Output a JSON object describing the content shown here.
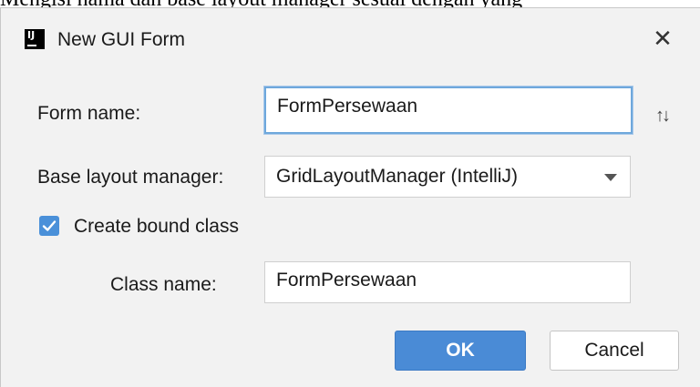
{
  "background_text": "Mengisi nama dan base layout manager sesuai dengan yang",
  "dialog": {
    "title": "New GUI Form",
    "app_icon_text": "IJ",
    "close_glyph": "✕"
  },
  "form": {
    "form_name_label": "Form name:",
    "form_name_value": "FormPersewaan",
    "base_layout_label": "Base layout manager:",
    "base_layout_value": "GridLayoutManager (IntelliJ)",
    "create_bound_label": "Create bound class",
    "create_bound_checked": true,
    "class_name_label": "Class name:",
    "class_name_value": "FormPersewaan"
  },
  "buttons": {
    "ok": "OK",
    "cancel": "Cancel"
  },
  "colors": {
    "accent": "#4a8bd6",
    "focus_border": "#6fa8dc",
    "checkbox": "#4a90d9"
  }
}
